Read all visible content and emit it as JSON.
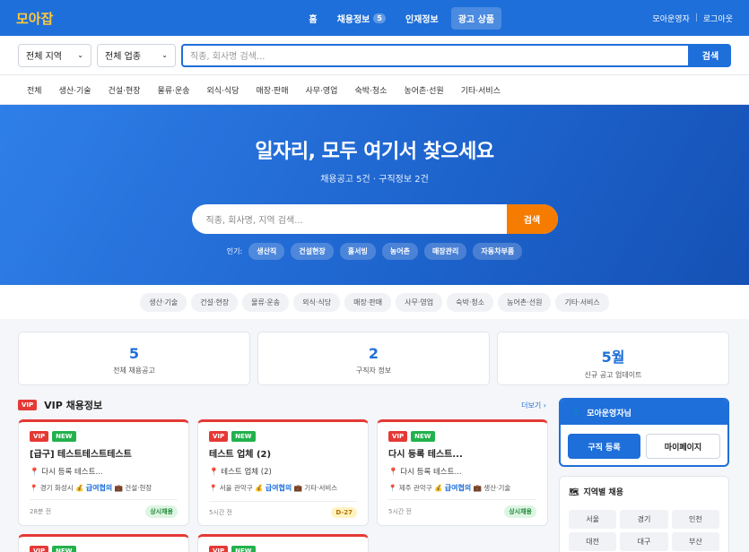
{
  "nav": {
    "logo": "모아잡",
    "items": [
      {
        "label": "홈"
      },
      {
        "label": "채용정보",
        "badge": "5"
      },
      {
        "label": "인재정보"
      },
      {
        "label": "광고 상품"
      }
    ],
    "user": "모아운영자",
    "logout": "로그아웃"
  },
  "search": {
    "region": "전체 지역",
    "industry": "전체 업종",
    "placeholder": "직종, 회사명 검색...",
    "button": "검색"
  },
  "categories": [
    "전체",
    "생산·기술",
    "건설·현장",
    "물류·운송",
    "외식·식당",
    "매장·판매",
    "사무·영업",
    "숙박·청소",
    "농어촌·선원",
    "기타·서비스"
  ],
  "hero": {
    "title": "일자리, 모두 여기서 찾으세요",
    "subtitle": "채용공고 5건 · 구직정보 2건",
    "placeholder": "직종, 회사명, 지역 검색...",
    "button": "검색",
    "popular_label": "인기:",
    "popular": [
      "생산직",
      "건설현장",
      "홀서빙",
      "농어촌",
      "매장관리",
      "자동차부품"
    ]
  },
  "chips": [
    "생산·기술",
    "건설·현장",
    "물류·운송",
    "외식·식당",
    "매장·판매",
    "사무·영업",
    "숙박·청소",
    "농어촌·선원",
    "기타·서비스"
  ],
  "stats": [
    {
      "n": "5",
      "l": "전체 채용공고"
    },
    {
      "n": "2",
      "l": "구직자 정보"
    },
    {
      "n": "5월",
      "l": "신규 공고 업데이트"
    }
  ],
  "vip": {
    "tag": "VIP",
    "title": "VIP 채용정보",
    "more": "더보기 ›",
    "cards": [
      {
        "vip": "VIP",
        "new": "NEW",
        "title": "[급구] 테스트테스트테스트",
        "company": "다시 등록 테스트...",
        "region": "경기 화성시",
        "salary": "급여협의",
        "industry": "건설·현장",
        "time": "28분 전",
        "badge": "상시채용",
        "badge_type": "g"
      },
      {
        "vip": "VIP",
        "new": "NEW",
        "title": "테스트 업체 (2)",
        "company": "테스트 업체 (2)",
        "region": "서울 관악구",
        "salary": "급여협의",
        "industry": "기타·서비스",
        "time": "5시간 전",
        "badge": "D-27",
        "badge_type": "o"
      },
      {
        "vip": "VIP",
        "new": "NEW",
        "title": "다시 등록 테스트...",
        "company": "다시 등록 테스트...",
        "region": "제주 관악구",
        "salary": "급여협의",
        "industry": "생산·기술",
        "time": "5시간 전",
        "badge": "상시채용",
        "badge_type": "g"
      },
      {
        "vip": "VIP",
        "new": "NEW"
      },
      {
        "vip": "VIP",
        "new": "NEW"
      }
    ]
  },
  "side": {
    "greeting": "모아운영자님",
    "register": "구직 등록",
    "mypage": "마이페이지",
    "region_title": "지역별 채용",
    "regions": [
      "서울",
      "경기",
      "인천",
      "대전",
      "대구",
      "부산"
    ]
  },
  "icons": {
    "pin": "map-pin-icon",
    "money": "money-bag-icon",
    "briefcase": "briefcase-icon",
    "user": "user-icon",
    "map": "map-icon"
  }
}
